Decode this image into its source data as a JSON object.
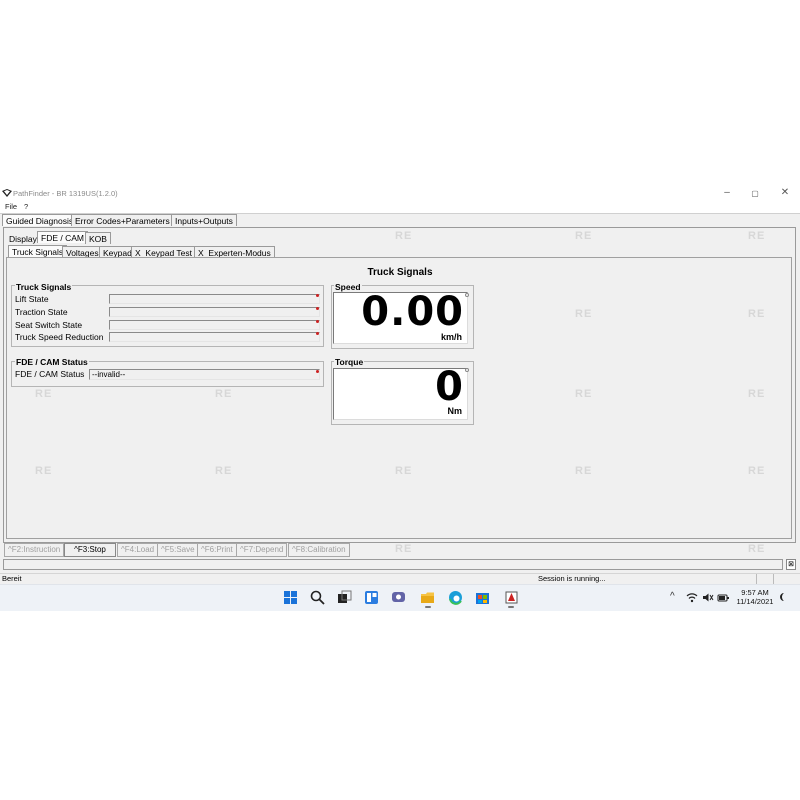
{
  "window": {
    "title": "PathFinder - BR 1319US(1.2.0)",
    "controls": [
      "–",
      "▢",
      "✕"
    ]
  },
  "menu": [
    "File",
    "?"
  ],
  "main_tabs": [
    {
      "label": "Guided Diagnosis",
      "active": true
    },
    {
      "label": "Error Codes+Parameters",
      "active": false
    },
    {
      "label": "Inputs+Outputs",
      "active": false
    }
  ],
  "sub_tabs": [
    {
      "label": "Display",
      "active": false
    },
    {
      "label": "FDE / CAM",
      "active": true
    },
    {
      "label": "KOB",
      "active": false
    }
  ],
  "inner_tabs": [
    {
      "label": "Truck Signals",
      "active": true
    },
    {
      "label": "Voltages",
      "active": false
    },
    {
      "label": "Keypad",
      "active": false
    },
    {
      "label": "X_Keypad Test",
      "active": false
    },
    {
      "label": "X_Experten-Modus",
      "active": false
    }
  ],
  "page_title": "Truck Signals",
  "truck_signals": {
    "title": "Truck Signals",
    "rows": [
      {
        "label": "Lift State",
        "value": ""
      },
      {
        "label": "Traction State",
        "value": ""
      },
      {
        "label": "Seat Switch State",
        "value": ""
      },
      {
        "label": "Truck Speed Reduction",
        "value": ""
      }
    ]
  },
  "fde_status": {
    "title": "FDE / CAM Status",
    "label": "FDE / CAM Status",
    "value": "--invalid--"
  },
  "speed": {
    "title": "Speed",
    "value": "0.00",
    "unit": "km/h"
  },
  "torque": {
    "title": "Torque",
    "value": "0",
    "unit": "Nm"
  },
  "function_buttons": [
    {
      "label": "^F2:Instruction",
      "enabled": false
    },
    {
      "label": "^F3:Stop",
      "enabled": true
    },
    {
      "label": "^F4:Load",
      "enabled": false
    },
    {
      "label": "^F5:Save",
      "enabled": false
    },
    {
      "label": "^F6:Print",
      "enabled": false
    },
    {
      "label": "^F7:Depend",
      "enabled": false
    },
    {
      "label": "^F8:Calibration",
      "enabled": false
    }
  ],
  "status_bar": {
    "left": "Bereit",
    "session": "Session is running..."
  },
  "taskbar": {
    "time": "9:57 AM",
    "date": "11/14/2021",
    "tray_chevron": "^"
  },
  "colors": {
    "accent_red": "#cc2222",
    "window_bg": "#f0f0f0",
    "taskbar_bg": "#eef2f7"
  }
}
